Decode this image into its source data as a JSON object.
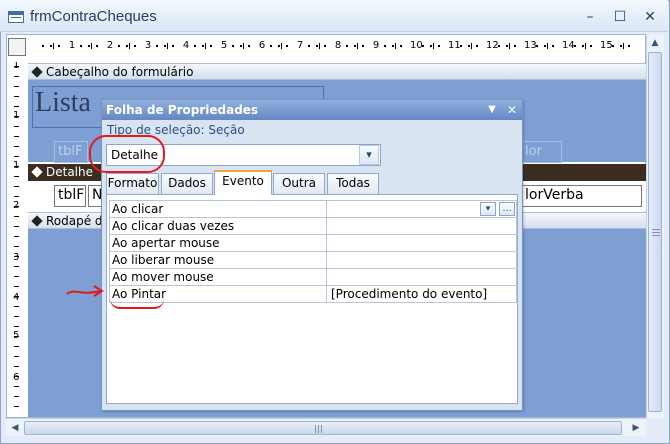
{
  "window": {
    "title": "frmContraCheques",
    "minimize_glyph": "–",
    "maximize_glyph": "☐",
    "close_glyph": "✕"
  },
  "ruler": {
    "horizontal_labels": [
      "1",
      "2",
      "3",
      "4",
      "5",
      "6",
      "7",
      "8",
      "9",
      "10",
      "11",
      "12",
      "13",
      "14",
      "15"
    ],
    "vertical_labels": [
      "1",
      "1",
      "1",
      "2",
      "3",
      "4",
      "5",
      "6"
    ]
  },
  "sections": {
    "header": "Cabeçalho do formulário",
    "detail": "Detalhe",
    "footer": "Rodapé do formulário"
  },
  "form": {
    "title": "Lista",
    "header_labels": [
      "tblF",
      "lor"
    ],
    "detail_controls": [
      "tblF",
      "N",
      "lorVerba"
    ]
  },
  "property_sheet": {
    "title": "Folha de Propriedades",
    "dropdown_glyph": "▼",
    "close_glyph": "✕",
    "selection_type_label": "Tipo de seleção:",
    "selection_type_value": "Seção",
    "selected_object": "Detalhe",
    "tabs": [
      "Formato",
      "Dados",
      "Evento",
      "Outra",
      "Todas"
    ],
    "active_tab": "Evento",
    "properties": [
      {
        "name": "Ao clicar",
        "value": ""
      },
      {
        "name": "Ao clicar duas vezes",
        "value": ""
      },
      {
        "name": "Ao apertar mouse",
        "value": ""
      },
      {
        "name": "Ao liberar mouse",
        "value": ""
      },
      {
        "name": "Ao mover mouse",
        "value": ""
      },
      {
        "name": "Ao Pintar",
        "value": "[Procedimento do evento]"
      }
    ],
    "builder_glyph": "…",
    "combo_arrow_glyph": "▾"
  },
  "annotation": {
    "color": "#e41b1b",
    "arrow_glyph": "→"
  },
  "colors": {
    "section_background": "#7e9fd4",
    "detail_bar": "#3b2d20",
    "active_tab_accent": "#f0a43a"
  }
}
